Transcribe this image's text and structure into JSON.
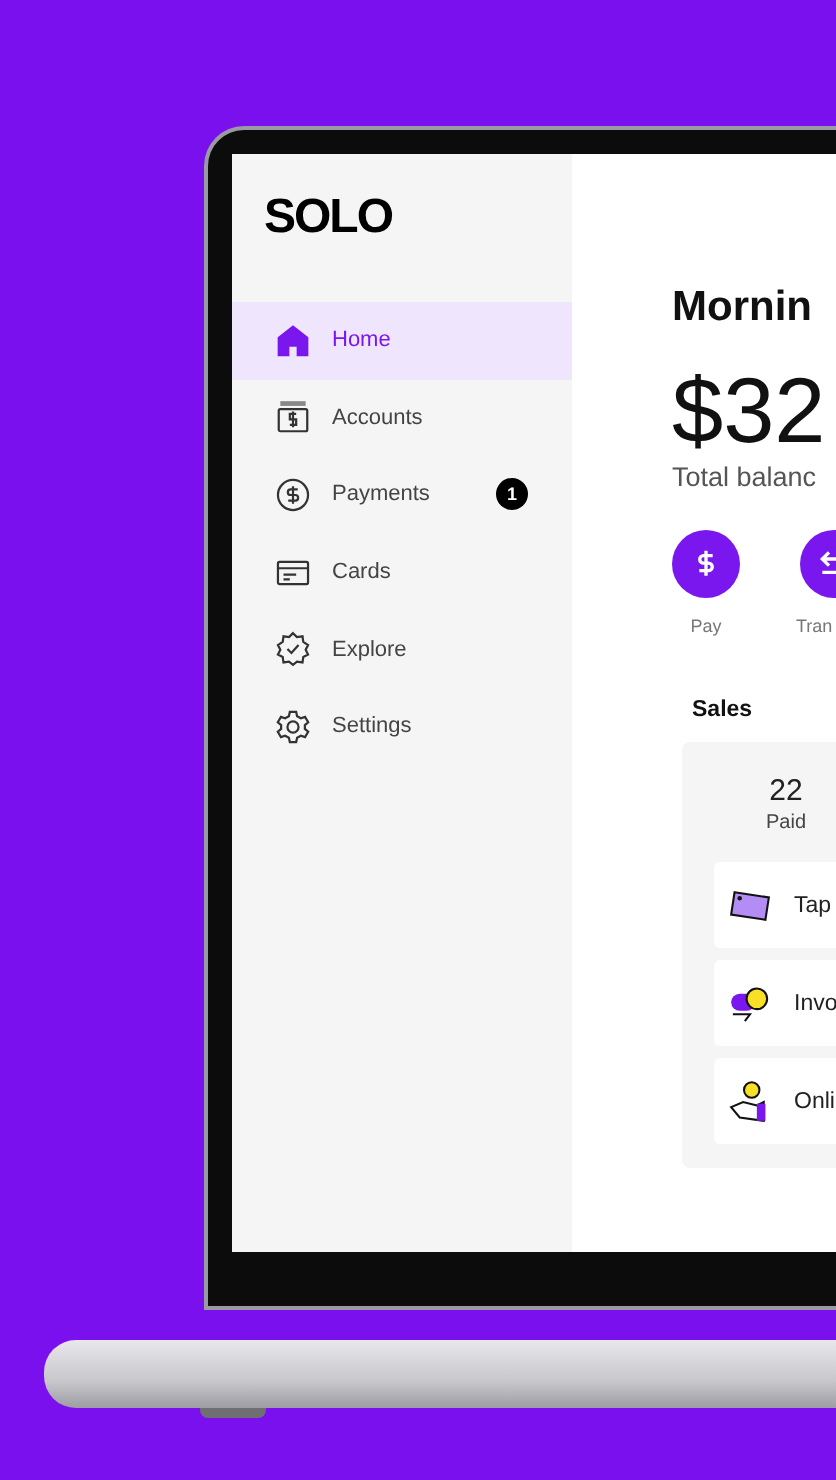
{
  "logo": "SOLO",
  "nav": [
    {
      "label": "Home",
      "selected": true
    },
    {
      "label": "Accounts",
      "selected": false
    },
    {
      "label": "Payments",
      "selected": false,
      "badge": "1"
    },
    {
      "label": "Cards",
      "selected": false
    },
    {
      "label": "Explore",
      "selected": false
    },
    {
      "label": "Settings",
      "selected": false
    }
  ],
  "greeting": "Mornin",
  "balance": "$32",
  "balance_label": "Total balanc",
  "actions": [
    {
      "label": "Pay"
    },
    {
      "label": "Tran"
    }
  ],
  "sales": {
    "title": "Sales",
    "stat_value": "22",
    "stat_label": "Paid",
    "rows": [
      {
        "label": "Tap"
      },
      {
        "label": "Invo"
      },
      {
        "label": "Onli"
      }
    ]
  }
}
